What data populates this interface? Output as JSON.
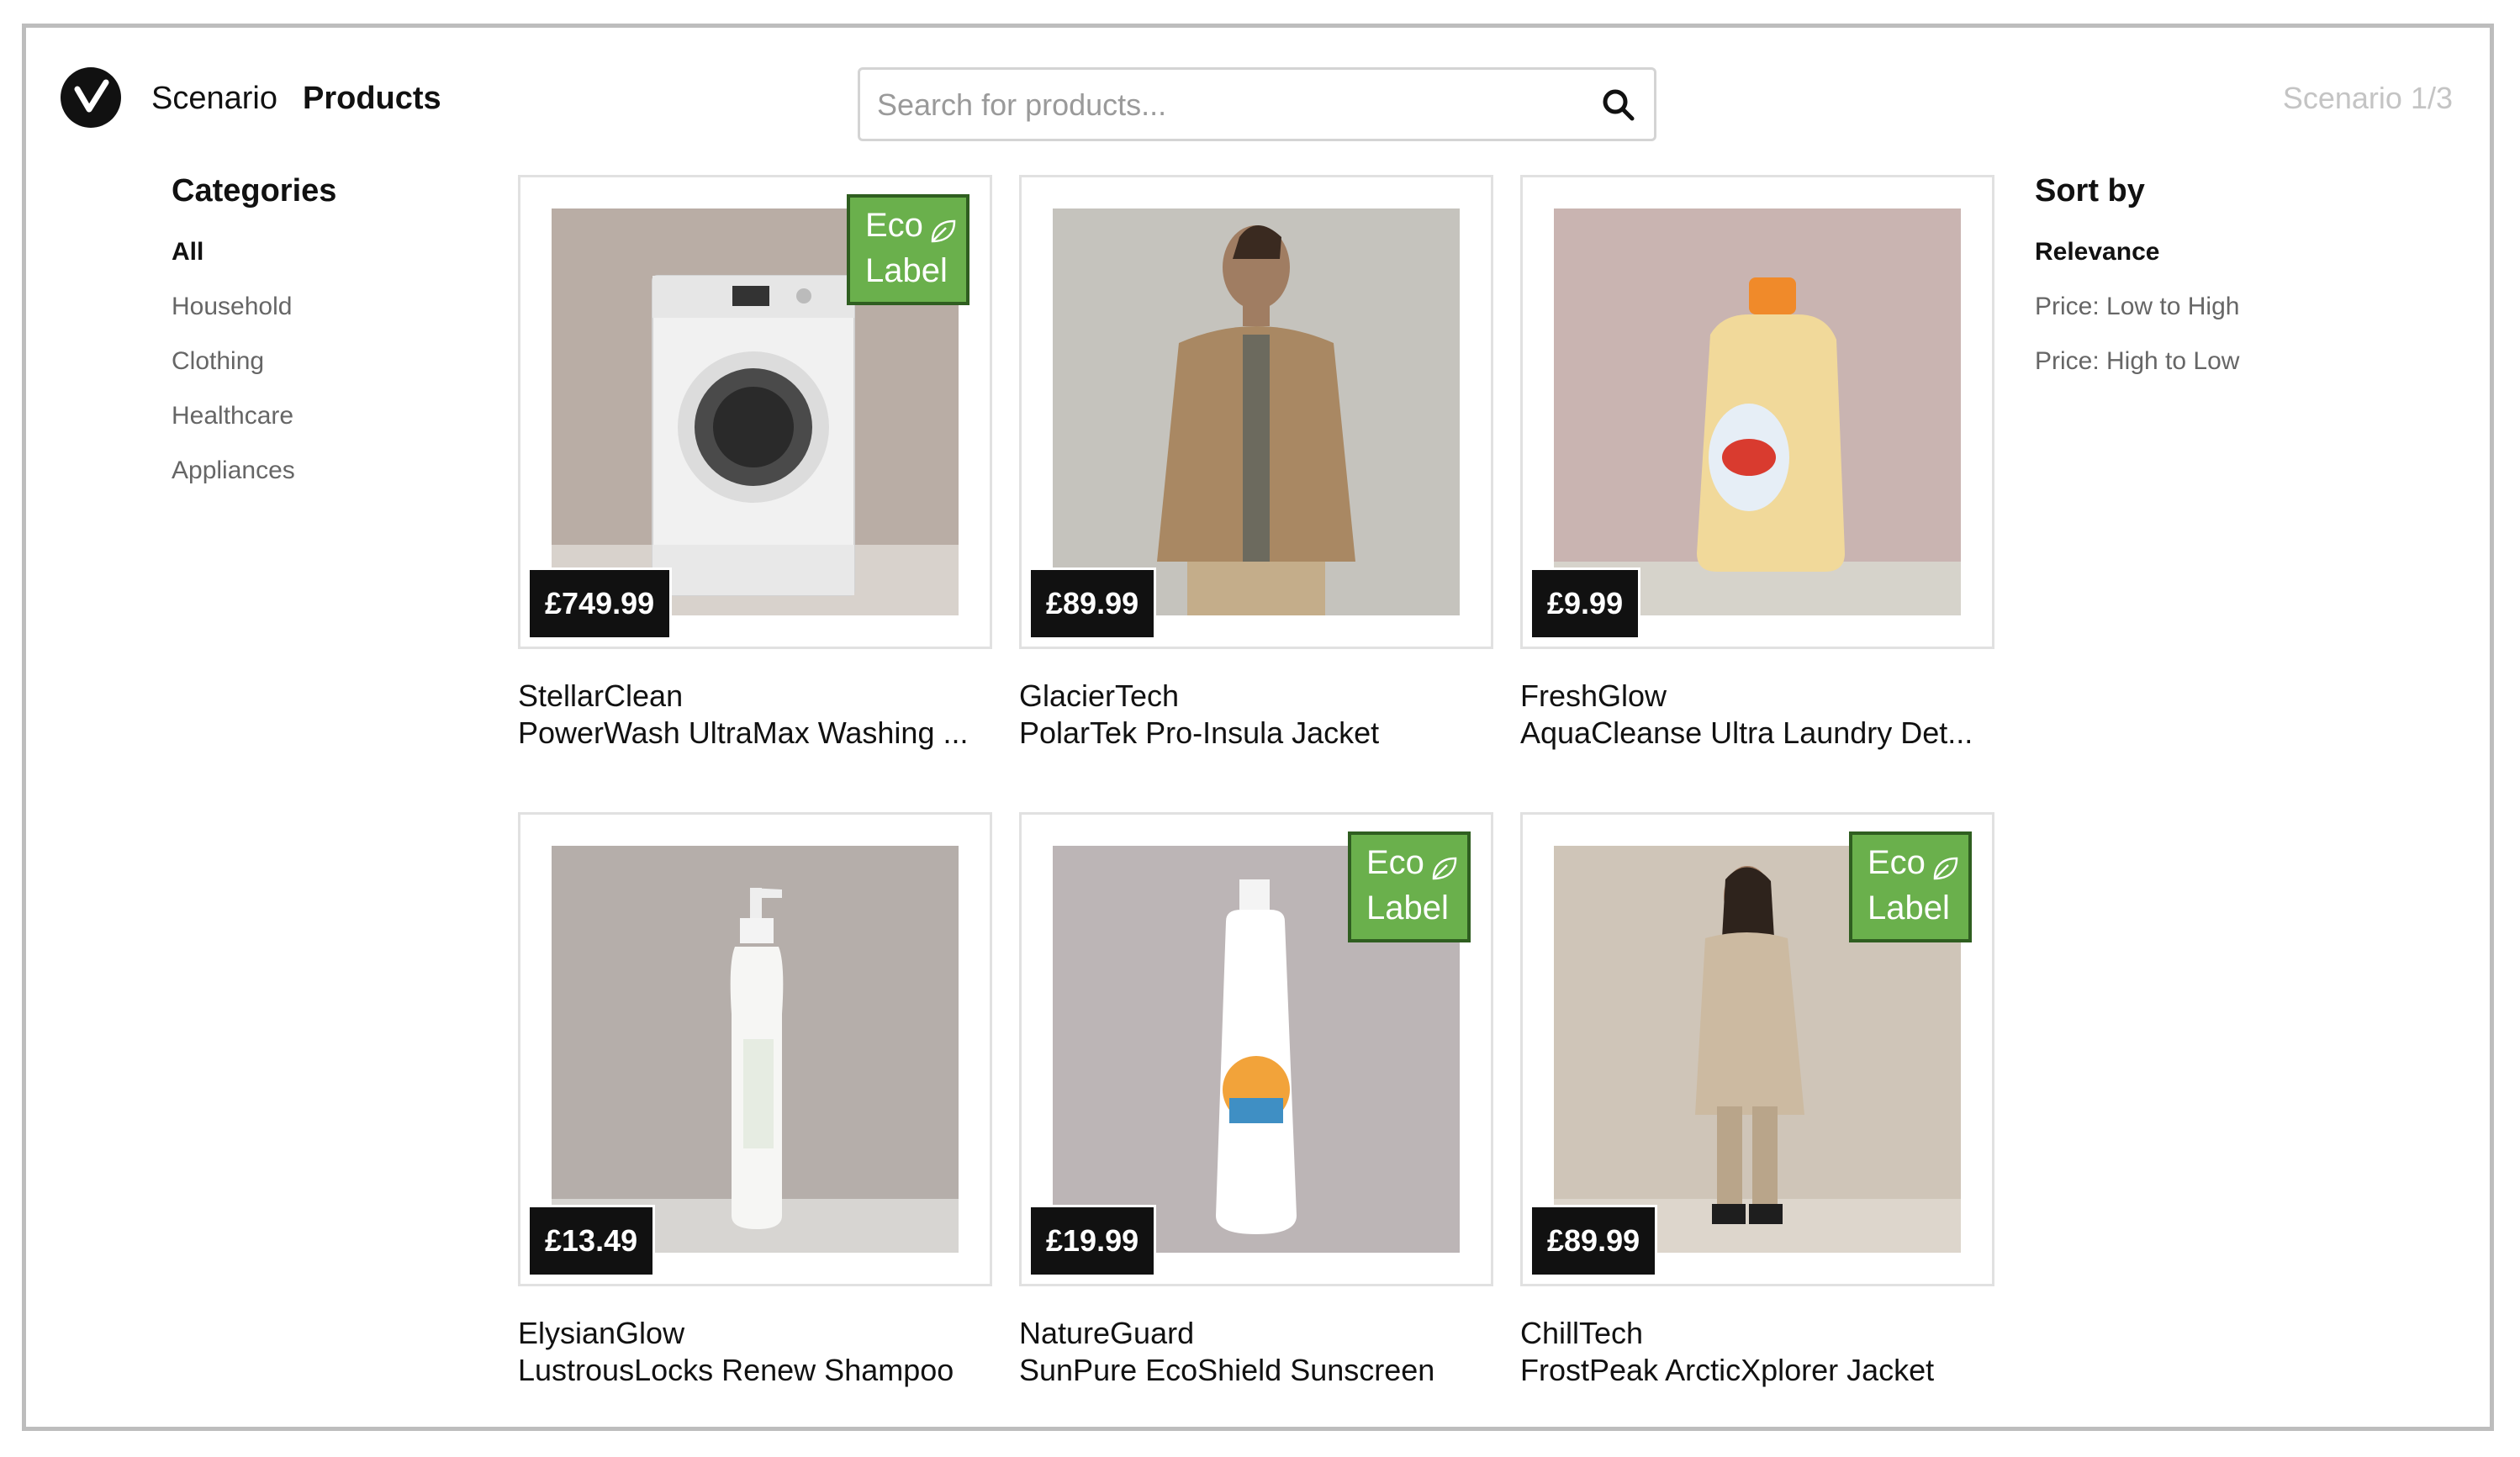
{
  "header": {
    "logo_icon": "v-check-logo-icon",
    "nav": [
      "Scenario",
      "Products"
    ],
    "active_nav": "Products",
    "search_placeholder": "Search for products...",
    "search_icon": "search-icon",
    "scenario_counter": "Scenario 1/3"
  },
  "categories": {
    "title": "Categories",
    "items": [
      "All",
      "Household",
      "Clothing",
      "Healthcare",
      "Appliances"
    ],
    "selected": "All"
  },
  "sort": {
    "title": "Sort by",
    "items": [
      "Relevance",
      "Price: Low to High",
      "Price: High to Low"
    ],
    "selected": "Relevance"
  },
  "eco_label": {
    "line1": "Eco",
    "line2": "Label",
    "color": "#6ab04c",
    "icon": "leaf-icon"
  },
  "products": [
    {
      "brand": "StellarClean",
      "name": "PowerWash UltraMax Washing ...",
      "price": "£749.99",
      "eco": true,
      "image": "washing-machine"
    },
    {
      "brand": "GlacierTech",
      "name": "PolarTek Pro-Insula Jacket",
      "price": "£89.99",
      "eco": false,
      "image": "man-in-jacket"
    },
    {
      "brand": "FreshGlow",
      "name": "AquaCleanse Ultra Laundry Det...",
      "price": "£9.99",
      "eco": false,
      "image": "detergent-bottle"
    },
    {
      "brand": "ElysianGlow",
      "name": "LustrousLocks Renew Shampoo",
      "price": "£13.49",
      "eco": false,
      "image": "shampoo-bottle"
    },
    {
      "brand": "NatureGuard",
      "name": "SunPure EcoShield Sunscreen",
      "price": "£19.99",
      "eco": true,
      "image": "sunscreen-bottle"
    },
    {
      "brand": "ChillTech",
      "name": "FrostPeak ArcticXplorer Jacket",
      "price": "£89.99",
      "eco": true,
      "image": "woman-in-coat"
    }
  ]
}
